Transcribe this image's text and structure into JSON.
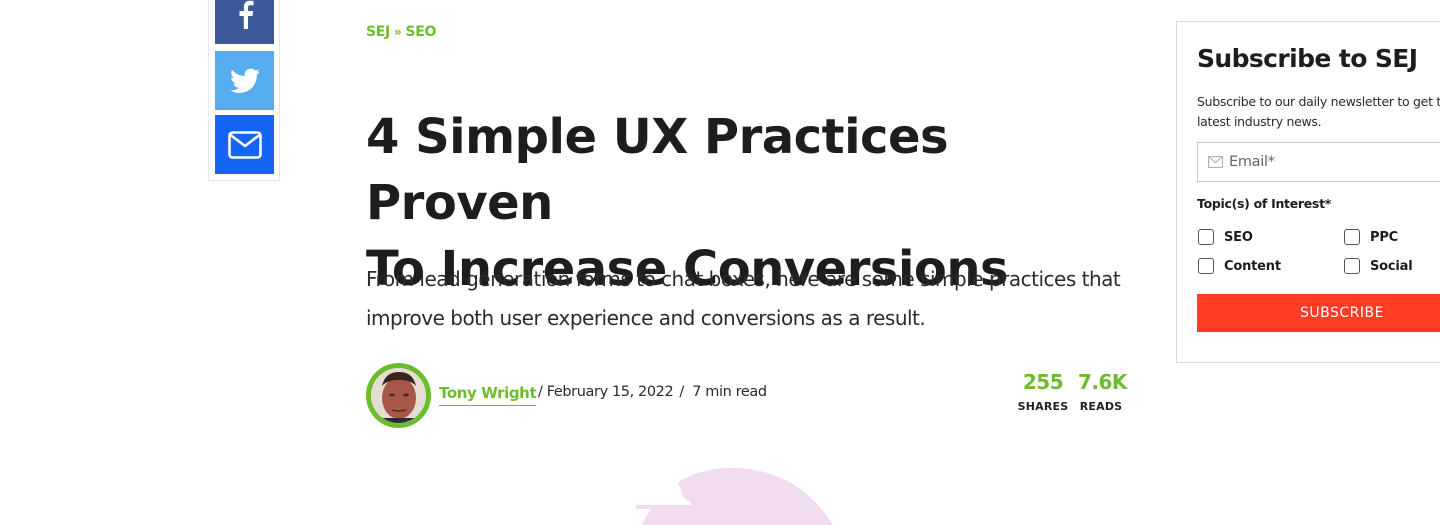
{
  "colors": {
    "brand_green": "#6cbd2d",
    "facebook": "#3b5998",
    "twitter": "#55acee",
    "email": "#1565f5",
    "subscribe_red": "#ff3c26",
    "hero_pink": "#f0dbf0"
  },
  "share": {
    "items": [
      {
        "name": "facebook",
        "icon": "facebook-icon"
      },
      {
        "name": "twitter",
        "icon": "twitter-icon"
      },
      {
        "name": "email",
        "icon": "envelope-icon"
      }
    ]
  },
  "breadcrumb": {
    "items": [
      "SEJ",
      "SEO"
    ],
    "separator": "»"
  },
  "article": {
    "title_line1": "4 Simple UX Practices Proven",
    "title_line2": "To Increase Conversions",
    "lead": "From lead generation forms to chat boxes, here are some simple practices that improve both user experience and conversions as a result.",
    "author": "Tony Wright",
    "date": "/ February 15, 2022",
    "read_time": "/  7 min read",
    "stats": {
      "shares_value": "255",
      "shares_label": "SHARES",
      "reads_value": "7.6K",
      "reads_label": "READS"
    }
  },
  "subscribe": {
    "title": "Subscribe to SEJ",
    "description": "Subscribe to our daily newsletter to get the latest industry news.",
    "email_placeholder": "Email*",
    "email_value": "",
    "topics_label": "Topic(s) of Interest*",
    "topics": [
      {
        "label": "SEO",
        "checked": false
      },
      {
        "label": "PPC",
        "checked": false
      },
      {
        "label": "Content",
        "checked": false
      },
      {
        "label": "Social",
        "checked": false
      }
    ],
    "button_label": "SUBSCRIBE"
  }
}
